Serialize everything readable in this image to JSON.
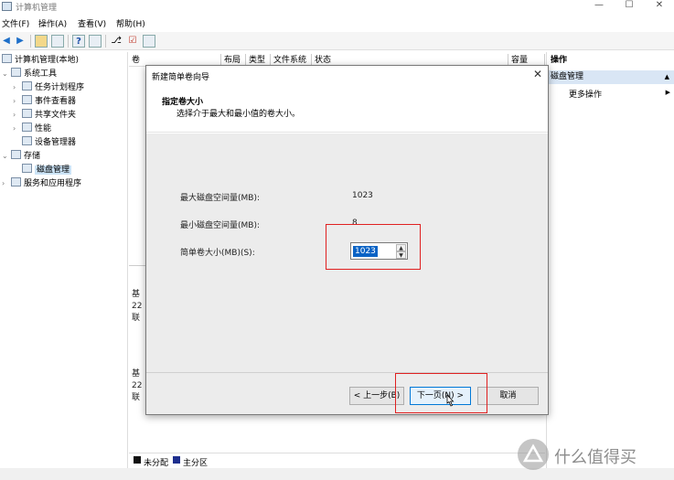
{
  "window": {
    "title": "计算机管理"
  },
  "menu": [
    "文件(F)",
    "操作(A)",
    "查看(V)",
    "帮助(H)"
  ],
  "tree": {
    "root": "计算机管理(本地)",
    "system_tools": "系统工具",
    "task_scheduler": "任务计划程序",
    "event_viewer": "事件查看器",
    "shared_folders": "共享文件夹",
    "performance": "性能",
    "device_manager": "设备管理器",
    "storage": "存储",
    "disk_management": "磁盘管理",
    "services": "服务和应用程序"
  },
  "volume_columns": [
    "卷",
    "布局",
    "类型",
    "文件系统",
    "状态",
    "容量"
  ],
  "disks": [
    {
      "line1": "基",
      "line2": "22",
      "line3": "联"
    },
    {
      "line1": "基",
      "line2": "22",
      "line3": "联"
    }
  ],
  "legend": {
    "unallocated": "未分配",
    "primary": "主分区"
  },
  "actions": {
    "header": "操作",
    "section": "磁盘管理",
    "more": "更多操作"
  },
  "dialog": {
    "title": "新建简单卷向导",
    "heading": "指定卷大小",
    "subheading": "选择介于最大和最小值的卷大小。",
    "max_label": "最大磁盘空间量(MB):",
    "max_value": "1023",
    "min_label": "最小磁盘空间量(MB):",
    "min_value": "8",
    "size_label": "简单卷大小(MB)(S):",
    "size_value": "1023",
    "back_button": "< 上一步(B)",
    "next_button": "下一页(N) >",
    "cancel_button": "取消"
  },
  "watermark": "什么值得买",
  "colors": {
    "selection": "#0b63c5",
    "highlight_box": "#e02020",
    "action_section": "#d9e6f5"
  }
}
